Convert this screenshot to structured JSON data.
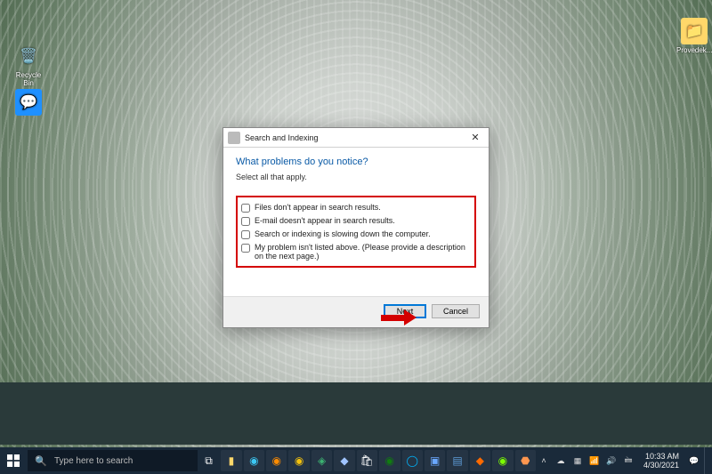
{
  "desktop": {
    "recycle_label": "Recycle Bin",
    "folder_label": "Provedek..."
  },
  "dialog": {
    "title": "Search and Indexing",
    "heading": "What problems do you notice?",
    "subtext": "Select all that apply.",
    "options": [
      "Files don't appear in search results.",
      "E-mail doesn't appear in search results.",
      "Search or indexing is slowing down the computer.",
      "My problem isn't listed above. (Please provide a description on the next page.)"
    ],
    "next_label": "Next",
    "cancel_label": "Cancel",
    "close_glyph": "✕"
  },
  "taskbar": {
    "search_placeholder": "Type here to search",
    "time": "10:33 AM",
    "date": "4/30/2021"
  }
}
